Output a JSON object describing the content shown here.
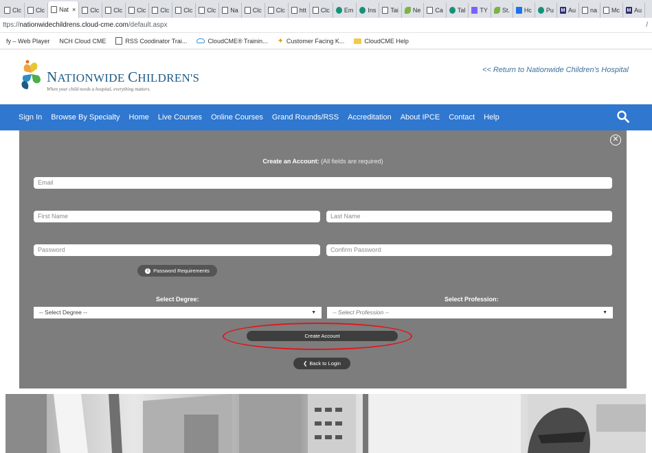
{
  "browser": {
    "tabs": [
      {
        "label": "Clc",
        "icon": "page-icon"
      },
      {
        "label": "Clc",
        "icon": "page-icon"
      },
      {
        "label": "Nat",
        "icon": "page-icon",
        "active": true
      },
      {
        "label": "Clc",
        "icon": "page-icon"
      },
      {
        "label": "Clc",
        "icon": "page-icon"
      },
      {
        "label": "Clc",
        "icon": "page-icon"
      },
      {
        "label": "Clc",
        "icon": "page-icon"
      },
      {
        "label": "Clc",
        "icon": "page-icon"
      },
      {
        "label": "Clc",
        "icon": "page-icon"
      },
      {
        "label": "Na",
        "icon": "page-icon"
      },
      {
        "label": "Clc",
        "icon": "page-icon"
      },
      {
        "label": "Clc",
        "icon": "page-icon"
      },
      {
        "label": "htt",
        "icon": "page-icon"
      },
      {
        "label": "Clc",
        "icon": "page-icon"
      },
      {
        "label": "Em",
        "icon": "teal-icon"
      },
      {
        "label": "Ins",
        "icon": "teal-icon"
      },
      {
        "label": "Tai",
        "icon": "page-icon"
      },
      {
        "label": "Ne",
        "icon": "leaf-icon"
      },
      {
        "label": "Ca",
        "icon": "page-icon"
      },
      {
        "label": "Tal",
        "icon": "teal-icon"
      },
      {
        "label": "TY",
        "icon": "purple-icon"
      },
      {
        "label": "St.",
        "icon": "leaf-icon"
      },
      {
        "label": "Hc",
        "icon": "blue-icon"
      },
      {
        "label": "Pu",
        "icon": "teal-icon"
      },
      {
        "label": "Au",
        "icon": "m-icon"
      },
      {
        "label": "na",
        "icon": "search-icon"
      },
      {
        "label": "Mc",
        "icon": "page-icon"
      },
      {
        "label": "Au",
        "icon": "m-icon"
      }
    ],
    "tab_close": "×",
    "address": {
      "scheme": "https://",
      "host": "nationwidechildrens.cloud-cme.com",
      "path": "/default.aspx",
      "shown_prefix": "ttps://"
    },
    "address_end_glyph": "/",
    "bookmarks": [
      {
        "label": "fy – Web Player",
        "icon": "none"
      },
      {
        "label": "NCH Cloud CME",
        "icon": "none"
      },
      {
        "label": "RSS Coodinator Trai...",
        "icon": "page-icon"
      },
      {
        "label": "CloudCME® Trainin...",
        "icon": "cloud-icon"
      },
      {
        "label": "Customer Facing K...",
        "icon": "star-icon"
      },
      {
        "label": "CloudCME Help",
        "icon": "folder-icon"
      }
    ]
  },
  "header": {
    "logo_name_1": "N",
    "logo_name_2": "ATIONWIDE ",
    "logo_name_3": "C",
    "logo_name_4": "HILDREN'S",
    "logo_tagline": "When your child needs a hospital, everything matters.",
    "return_link": "<< Return to Nationwide Children's Hospital"
  },
  "nav": {
    "items": [
      "Sign In",
      "Browse By Specialty",
      "Home",
      "Live Courses",
      "Online Courses",
      "Grand Rounds/RSS",
      "Accreditation",
      "About IPCE",
      "Contact",
      "Help"
    ]
  },
  "form": {
    "close_glyph": "✕",
    "title_bold": "Create an Account:",
    "title_rest": " (All fields are required)",
    "email_placeholder": "Email",
    "first_name_placeholder": "First Name",
    "last_name_placeholder": "Last Name",
    "password_placeholder": "Password",
    "confirm_password_placeholder": "Confirm Password",
    "password_requirements_label": "Password Requirements",
    "info_glyph": "i",
    "degree_label": "Select Degree:",
    "degree_value": "-- Select Degree --",
    "profession_label": "Select Profession:",
    "profession_value": "-- Select Profession --",
    "caret": "▼",
    "create_account_label": "Create Account",
    "back_label": "Back to Login",
    "back_glyph": "❮"
  },
  "colors": {
    "nav_blue": "#2f77cf",
    "panel_gray": "#7d7d7d",
    "button_dark": "#3e3e3e",
    "highlight_red": "#e0161b"
  }
}
